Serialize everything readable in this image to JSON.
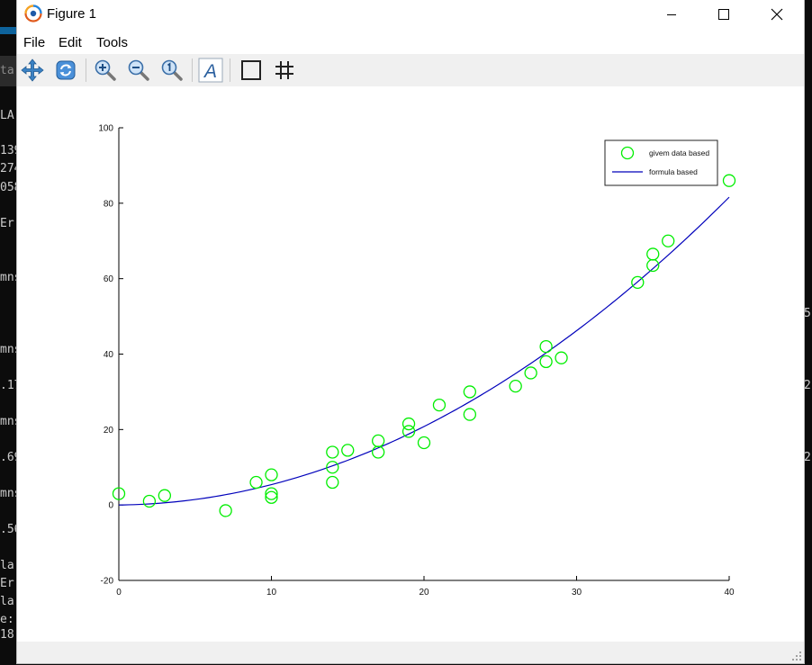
{
  "window": {
    "title": "Figure 1",
    "menu": [
      "File",
      "Edit",
      "Tools"
    ]
  },
  "toolbar": {
    "tools": [
      "pan-icon",
      "rotate-icon",
      "zoom-in-icon",
      "zoom-out-icon",
      "zoom-reset-icon",
      "text-icon",
      "axes-box-icon",
      "grid-icon"
    ]
  },
  "background_terminal": {
    "left_fragments": [
      "LA",
      "139",
      "274",
      "058",
      "Er",
      "mns",
      "mns",
      ".17",
      "mns",
      ".69",
      "mns",
      ".56",
      "la",
      "Er",
      "la",
      "e:",
      "18"
    ],
    "right_fragments": [
      "5.",
      "2.",
      "2."
    ],
    "tab_fragment": "ta"
  },
  "colors": {
    "marker": "#00ee00",
    "line": "#0000bb",
    "axis": "#000000"
  },
  "chart_data": {
    "type": "scatter",
    "title": "",
    "xlabel": "",
    "ylabel": "",
    "xlim": [
      0,
      40
    ],
    "ylim": [
      -20,
      100
    ],
    "xticks": [
      0,
      10,
      20,
      30,
      40
    ],
    "yticks": [
      -20,
      0,
      20,
      40,
      60,
      80,
      100
    ],
    "grid": false,
    "legend_position": "top-right",
    "series": [
      {
        "name": "givem data based",
        "kind": "markers",
        "marker": "circle",
        "x": [
          0,
          2,
          3,
          7,
          9,
          10,
          10,
          10,
          14,
          14,
          14,
          15,
          17,
          17,
          19,
          19,
          20,
          21,
          23,
          23,
          26,
          27,
          28,
          28,
          29,
          34,
          35,
          35,
          36,
          40
        ],
        "y": [
          3,
          1,
          2.5,
          -1.5,
          6,
          3,
          2,
          8,
          6,
          10,
          14,
          14.5,
          14,
          17,
          21.5,
          19.5,
          16.5,
          26.5,
          24,
          30,
          31.5,
          35,
          42,
          38,
          39,
          59,
          66.5,
          63.5,
          70,
          86
        ]
      },
      {
        "name": "formula based",
        "kind": "line",
        "curve": "y = 0.05*x^2 + 0.04*x",
        "x": [
          0,
          2.5,
          5,
          7.5,
          10,
          12.5,
          15,
          17.5,
          20,
          22.5,
          25,
          27.5,
          30,
          32.5,
          35,
          37.5,
          40
        ],
        "y": [
          0,
          0.41,
          1.45,
          3.11,
          5.4,
          8.31,
          11.85,
          16.01,
          20.8,
          26.21,
          32.25,
          38.91,
          46.2,
          54.11,
          62.65,
          71.81,
          81.6
        ]
      }
    ]
  }
}
